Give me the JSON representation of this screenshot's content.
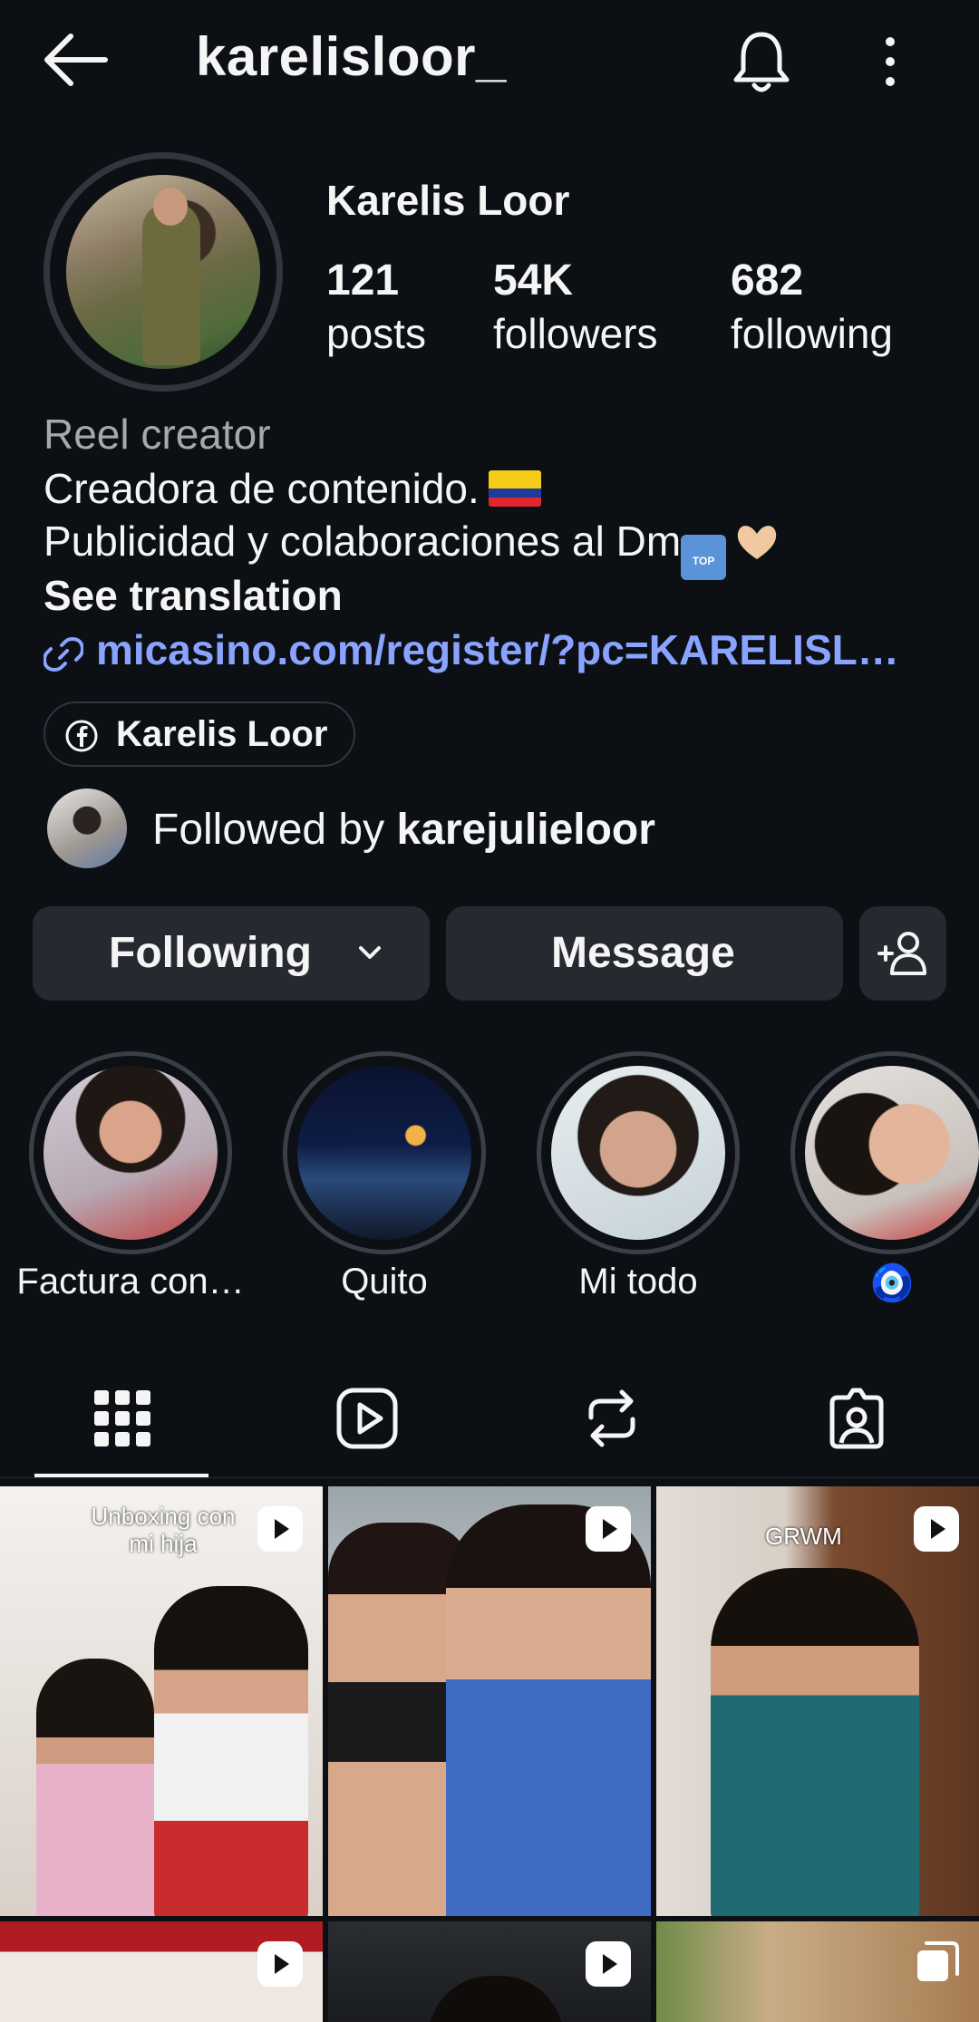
{
  "header": {
    "username": "karelisloor_"
  },
  "profile": {
    "display_name": "Karelis Loor",
    "stats": [
      {
        "value": "121",
        "label": "posts"
      },
      {
        "value": "54K",
        "label": "followers"
      },
      {
        "value": "682",
        "label": "following"
      }
    ],
    "category": "Reel creator",
    "bio_line1": "Creadora de contenido.",
    "bio_line2": "Publicidad y colaboraciones al Dm",
    "see_translation": "See translation",
    "link": "micasino.com/register/?pc=KARELISL…",
    "facebook_name": "Karelis Loor",
    "followed_by_prefix": "Followed by ",
    "followed_by_user": "karejulieloor"
  },
  "actions": {
    "following_label": "Following",
    "message_label": "Message"
  },
  "highlights": [
    {
      "label": "Factura con…"
    },
    {
      "label": "Quito"
    },
    {
      "label": "Mi todo"
    },
    {
      "label": "🧿"
    }
  ],
  "tabs": [
    "grid-icon",
    "reels-icon",
    "reposts-icon",
    "tagged-icon"
  ],
  "posts": [
    {
      "caption": "Unboxing con mi hija",
      "type": "reel"
    },
    {
      "caption": "",
      "type": "reel"
    },
    {
      "caption": "GRWM",
      "type": "reel"
    },
    {
      "caption": "",
      "type": "reel"
    },
    {
      "caption": "",
      "type": "reel"
    },
    {
      "caption": "",
      "type": "carousel"
    }
  ],
  "colors": {
    "background": "#0c1014",
    "link": "#8aa3ff",
    "button": "#262a30"
  }
}
